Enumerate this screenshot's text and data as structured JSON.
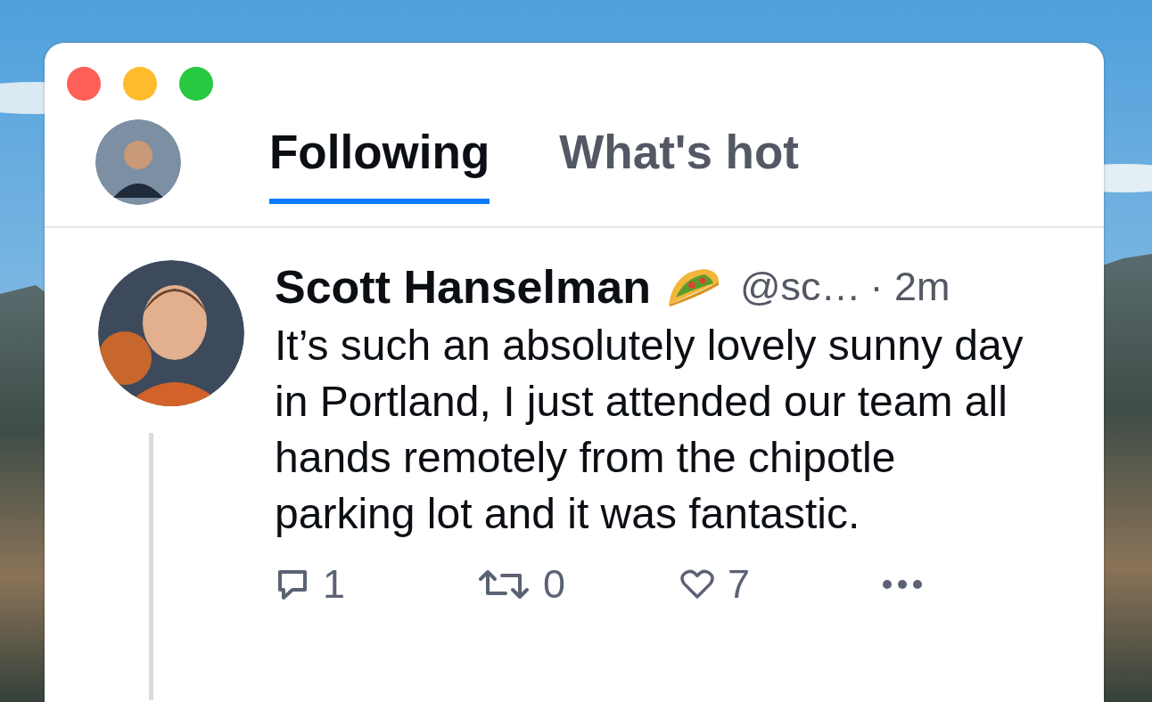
{
  "tabs": [
    {
      "label": "Following",
      "selected": true
    },
    {
      "label": "What's hot",
      "selected": false
    }
  ],
  "post": {
    "author": "Scott Hanselman",
    "handle": "@sc…",
    "time": "· 2m",
    "text": "It’s such an absolutely lovely sunny day in Portland, I just attended our team all hands remotely from the chipotle parking lot and it was fantastic.",
    "actions": [
      {
        "kind": "reply",
        "count": "1"
      },
      {
        "kind": "repost",
        "count": "0"
      },
      {
        "kind": "like",
        "count": "7"
      },
      {
        "kind": "more"
      }
    ]
  }
}
